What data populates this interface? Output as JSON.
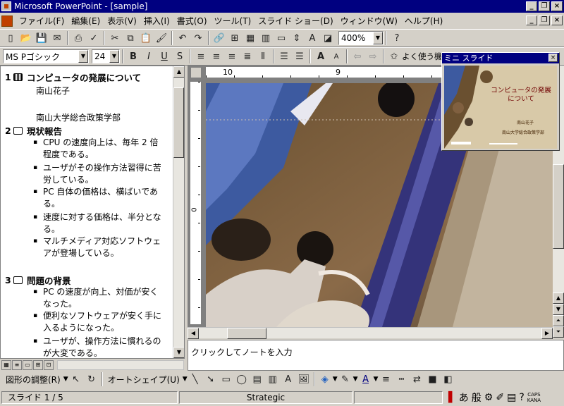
{
  "window": {
    "title": "Microsoft PowerPoint - [sample]"
  },
  "menu": [
    "ファイル(F)",
    "編集(E)",
    "表示(V)",
    "挿入(I)",
    "書式(O)",
    "ツール(T)",
    "スライド ショー(D)",
    "ウィンドウ(W)",
    "ヘルプ(H)"
  ],
  "toolbar": {
    "zoom": "400%"
  },
  "format": {
    "font": "MS Pゴシック",
    "size": "24",
    "common_tasks": "よく使う機能"
  },
  "outline": {
    "slides": [
      {
        "num": "1",
        "title": "コンピュータの発展について",
        "subs": [
          "南山花子",
          "南山大学総合政策学部"
        ]
      },
      {
        "num": "2",
        "title": "現状報告",
        "bullets": [
          [
            "CPU の速度向上は、毎年 2 倍",
            "程度である。"
          ],
          [
            "ユーザがその操作方法習得に苦",
            "労している。"
          ],
          [
            "PC 自体の価格は、横ばいであ",
            "る。"
          ],
          [
            "速度に対する価格は、半分とな",
            "る。"
          ],
          [
            "マルチメディア対応ソフトウェ",
            "アが登場している。"
          ]
        ]
      },
      {
        "num": "3",
        "title": "問題の背景",
        "bullets": [
          [
            "PC の速度が向上、対価が安く",
            "なった。"
          ],
          [
            "便利なソフトウェアが安く手に",
            "入るようになった。"
          ],
          [
            "ユーザが、操作方法に慣れるの",
            "が大変である。"
          ]
        ]
      }
    ]
  },
  "ruler": {
    "h_labels": [
      "10",
      "9"
    ],
    "v_label": "0"
  },
  "notes": {
    "placeholder": "クリックしてノートを入力"
  },
  "mini_slide": {
    "title": "ミニ スライド",
    "slide_title": "コンピュータの発展について",
    "author": "南山花子",
    "affiliation": "南山大学総合政策学部"
  },
  "drawing": {
    "draw_menu": "図形の調整(R)",
    "autoshape": "オートシェイプ(U)"
  },
  "status": {
    "slide": "スライド 1 / 5",
    "design": "Strategic"
  },
  "ime": {
    "mode1": "あ",
    "mode2": "般",
    "caps": "CAPS",
    "kana": "KANA"
  }
}
